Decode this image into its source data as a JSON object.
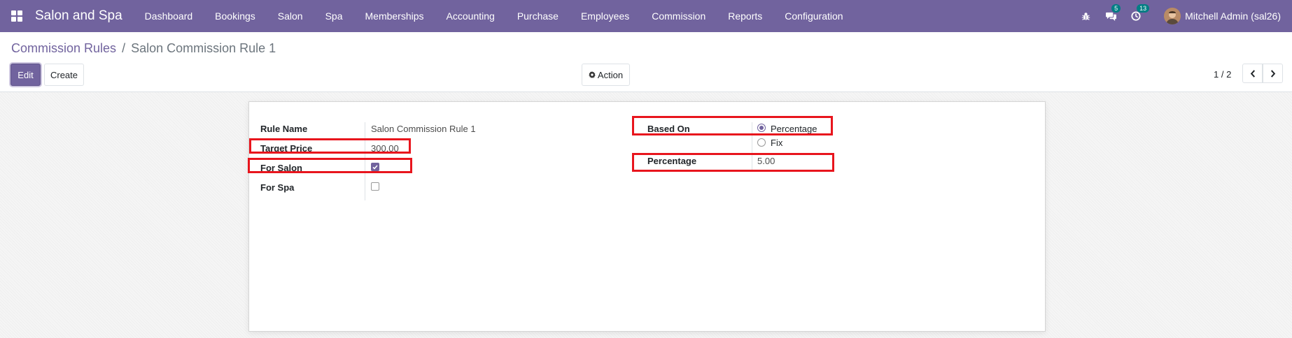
{
  "navbar": {
    "app_title": "Salon and Spa",
    "menu": [
      "Dashboard",
      "Bookings",
      "Salon",
      "Spa",
      "Memberships",
      "Accounting",
      "Purchase",
      "Employees",
      "Commission",
      "Reports",
      "Configuration"
    ],
    "messages_count": "5",
    "activities_count": "13",
    "user_name": "Mitchell Admin (sal26)"
  },
  "breadcrumb": {
    "parent": "Commission Rules",
    "separator": "/",
    "current": "Salon Commission Rule 1"
  },
  "toolbar": {
    "edit_label": "Edit",
    "create_label": "Create",
    "action_label": "Action"
  },
  "pager": {
    "value": "1 / 2"
  },
  "form": {
    "rule_name_label": "Rule Name",
    "rule_name_value": "Salon Commission Rule 1",
    "target_price_label": "Target Price",
    "target_price_value": "300.00",
    "for_salon_label": "For Salon",
    "for_salon_checked": true,
    "for_spa_label": "For Spa",
    "for_spa_checked": false,
    "based_on_label": "Based On",
    "based_on_options": [
      "Percentage",
      "Fix"
    ],
    "based_on_selected": "Percentage",
    "percentage_label": "Percentage",
    "percentage_value": "5.00"
  },
  "colors": {
    "brand": "#71639e",
    "badge": "#017e84",
    "highlight": "#e8151d"
  }
}
